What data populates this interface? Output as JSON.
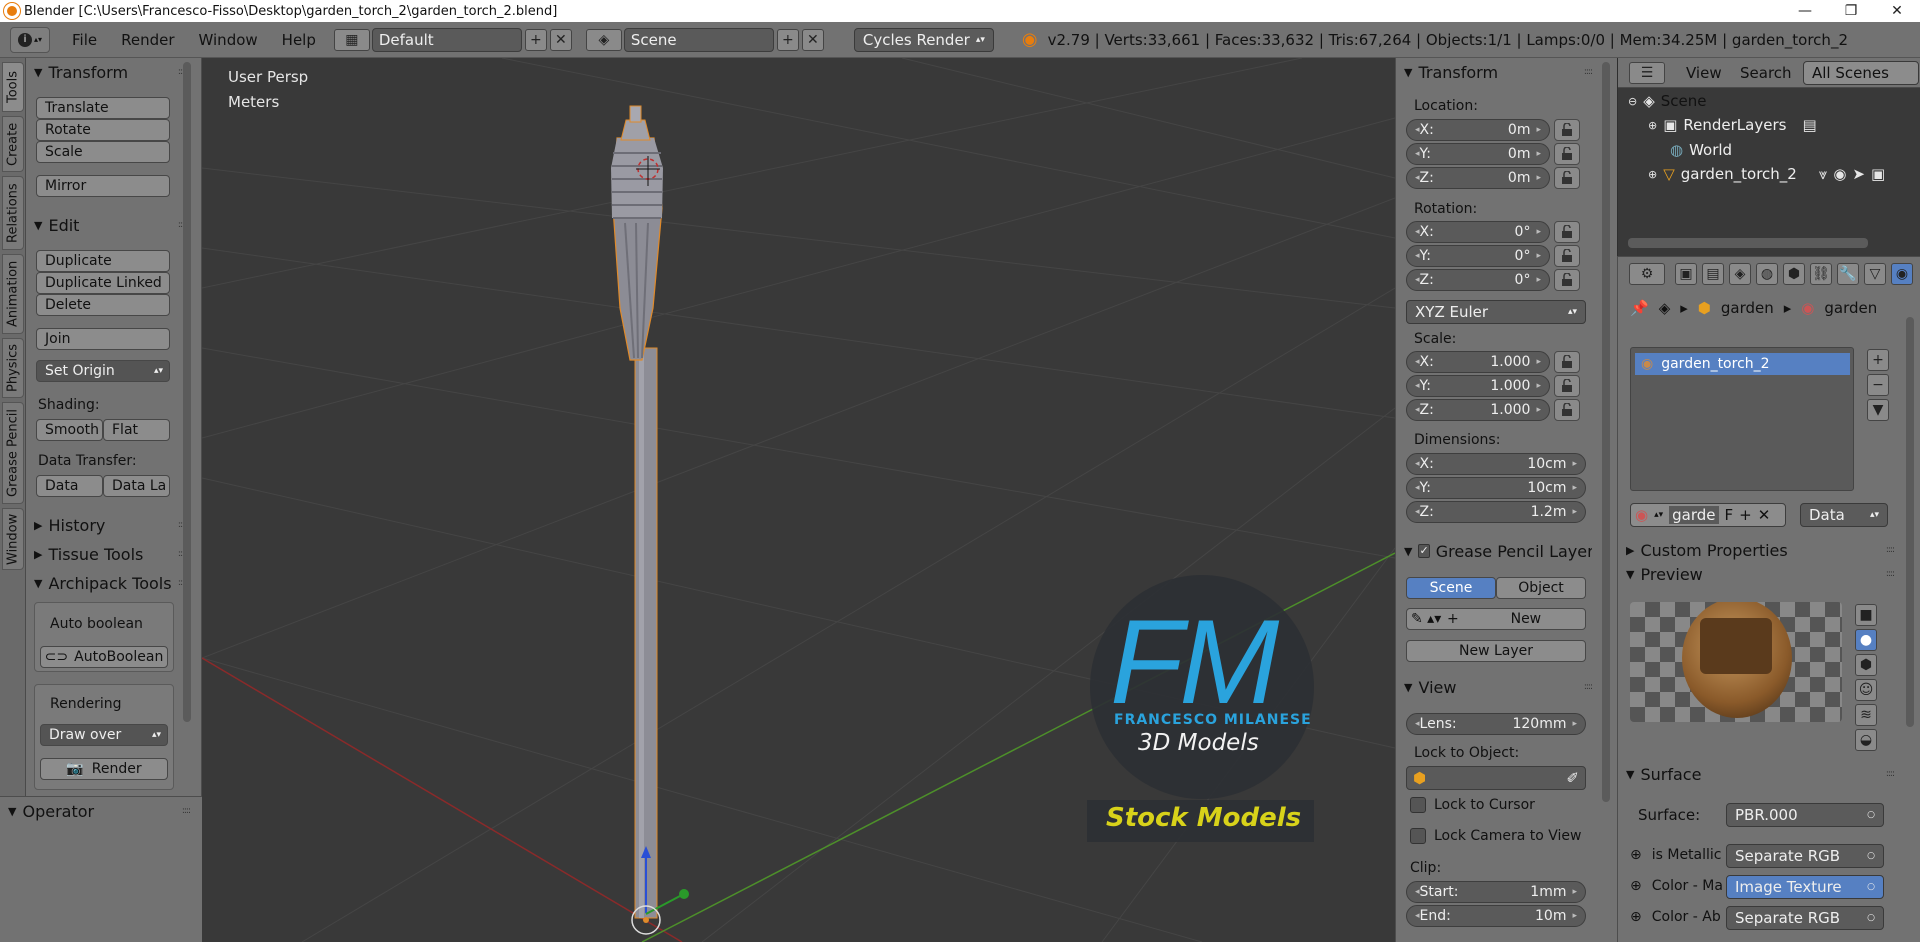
{
  "titlebar": {
    "title": "Blender [C:\\Users\\Francesco-Fisso\\Desktop\\garden_torch_2\\garden_torch_2.blend]"
  },
  "menubar": {
    "menus": [
      "File",
      "Render",
      "Window",
      "Help"
    ],
    "screen_layout": "Default",
    "scene": "Scene",
    "render_engine": "Cycles Render",
    "stats": "v2.79 | Verts:33,661 | Faces:33,632 | Tris:67,264 | Objects:1/1 | Lamps:0/0 | Mem:34.25M | garden_torch_2"
  },
  "vtabs": [
    "Tools",
    "Create",
    "Relations",
    "Animation",
    "Physics",
    "Grease Pencil",
    "Window"
  ],
  "toolshelf": {
    "transform_title": "Transform",
    "translate": "Translate",
    "rotate": "Rotate",
    "scale": "Scale",
    "mirror": "Mirror",
    "edit_title": "Edit",
    "duplicate": "Duplicate",
    "duplicate_linked": "Duplicate Linked",
    "delete": "Delete",
    "join": "Join",
    "set_origin": "Set Origin",
    "shading_label": "Shading:",
    "smooth": "Smooth",
    "flat": "Flat",
    "data_transfer_label": "Data Transfer:",
    "data": "Data",
    "data_la": "Data La",
    "history": "History",
    "tissue_tools": "Tissue Tools",
    "archipack_tools": "Archipack Tools",
    "auto_boolean_label": "Auto boolean",
    "autoboolean_btn": "AutoBoolean",
    "rendering_label": "Rendering",
    "draw_over": "Draw over",
    "render_btn": "Render"
  },
  "operator": {
    "title": "Operator"
  },
  "viewport": {
    "view_name": "User Persp",
    "units": "Meters",
    "watermark_letters": "FM",
    "watermark_name": "FRANCESCO MILANESE",
    "watermark_sub": "3D Models",
    "watermark_banner": "Stock Models"
  },
  "npanel": {
    "transform_title": "Transform",
    "location_label": "Location:",
    "location": {
      "x": "0m",
      "y": "0m",
      "z": "0m"
    },
    "rotation_label": "Rotation:",
    "rotation": {
      "x": "0°",
      "y": "0°",
      "z": "0°"
    },
    "rotation_mode": "XYZ Euler",
    "scale_label": "Scale:",
    "scale": {
      "x": "1.000",
      "y": "1.000",
      "z": "1.000"
    },
    "dimensions_label": "Dimensions:",
    "dimensions": {
      "x": "10cm",
      "y": "10cm",
      "z": "1.2m"
    },
    "axis_x": "X:",
    "axis_y": "Y:",
    "axis_z": "Z:",
    "grease_pencil_title": "Grease Pencil Layer",
    "scene_tab": "Scene",
    "object_tab": "Object",
    "new_btn": "New",
    "new_layer_btn": "New Layer",
    "view_title": "View",
    "lens_label": "Lens:",
    "lens_value": "120mm",
    "lock_to_object_label": "Lock to Object:",
    "lock_to_cursor": "Lock to Cursor",
    "lock_camera_to_view": "Lock Camera to View",
    "clip_label": "Clip:",
    "clip_start_label": "Start:",
    "clip_start": "1mm",
    "clip_end_label": "End:",
    "clip_end": "10m"
  },
  "outliner": {
    "menus": [
      "View",
      "Search"
    ],
    "filter": "All Scenes",
    "items": [
      "Scene",
      "RenderLayers",
      "World",
      "garden_torch_2"
    ]
  },
  "properties": {
    "breadcrumb": [
      "garden",
      "garden"
    ],
    "material_slot": "garden_torch_2",
    "material_name_short": "garde",
    "material_f": "F",
    "data_dropdown": "Data",
    "custom_properties": "Custom Properties",
    "preview_title": "Preview",
    "surface_title": "Surface",
    "surface_label": "Surface:",
    "surface_value": "PBR.000",
    "rows": [
      {
        "label": "is Metallic",
        "value": "Separate RGB"
      },
      {
        "label": "Color - Ma",
        "value": "Image Texture"
      },
      {
        "label": "Color - Ab",
        "value": "Separate RGB"
      }
    ]
  },
  "colors": {
    "accent": "#5680c2",
    "selection": "#3d6bb0",
    "watermark_blue": "#2aa3dd",
    "watermark_yellow": "#d8d21a"
  }
}
